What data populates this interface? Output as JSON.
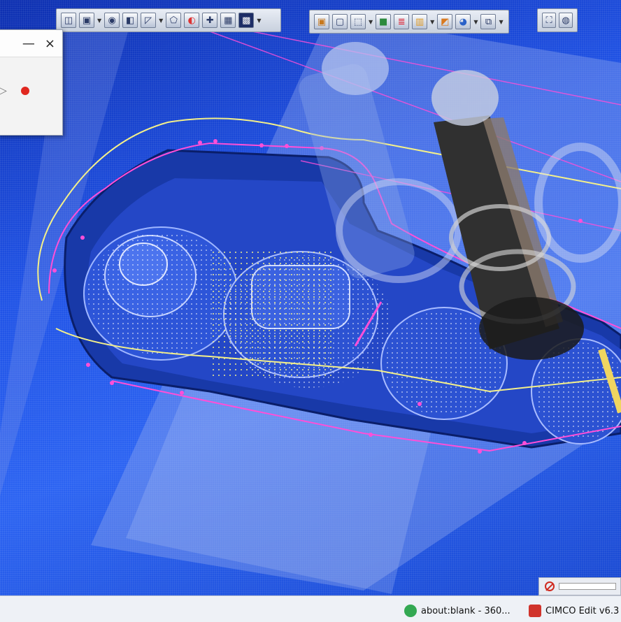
{
  "window": {
    "close_glyph": "×",
    "minimize_glyph": "—"
  },
  "toolbar_left": {
    "icons": [
      "view-cube-icon",
      "select-icon",
      "render-mode-icon",
      "shade-icon",
      "cut-plane-icon",
      "material-icon",
      "color-icon",
      "axis-icon",
      "grid-icon"
    ]
  },
  "toolbar_right": {
    "icons": [
      "stock-icon",
      "part-icon",
      "box-icon",
      "solid-icon",
      "layers-icon",
      "toolpath-icon",
      "palette-icon",
      "sphere-icon",
      "layout-icon"
    ]
  },
  "toolbar_far": {
    "icons": [
      "fit-view-icon",
      "globe-icon"
    ]
  },
  "simulation_panel": {
    "controls": [
      "play-icon",
      "record-icon"
    ]
  },
  "status": {
    "progress_fraction": 0.0
  },
  "taskbar": {
    "items": [
      {
        "label": "about:blank - 360...",
        "icon": "browser-icon",
        "color": "#33a852"
      },
      {
        "label": "CIMCO Edit v6.3",
        "icon": "cimco-icon",
        "color": "#d0342c"
      }
    ]
  },
  "colors": {
    "background": "#1f52e6",
    "toolpath_magenta": "#ff4fd8",
    "toolpath_yellow": "#f4f08a",
    "tool_dark": "#3a3a3a"
  }
}
